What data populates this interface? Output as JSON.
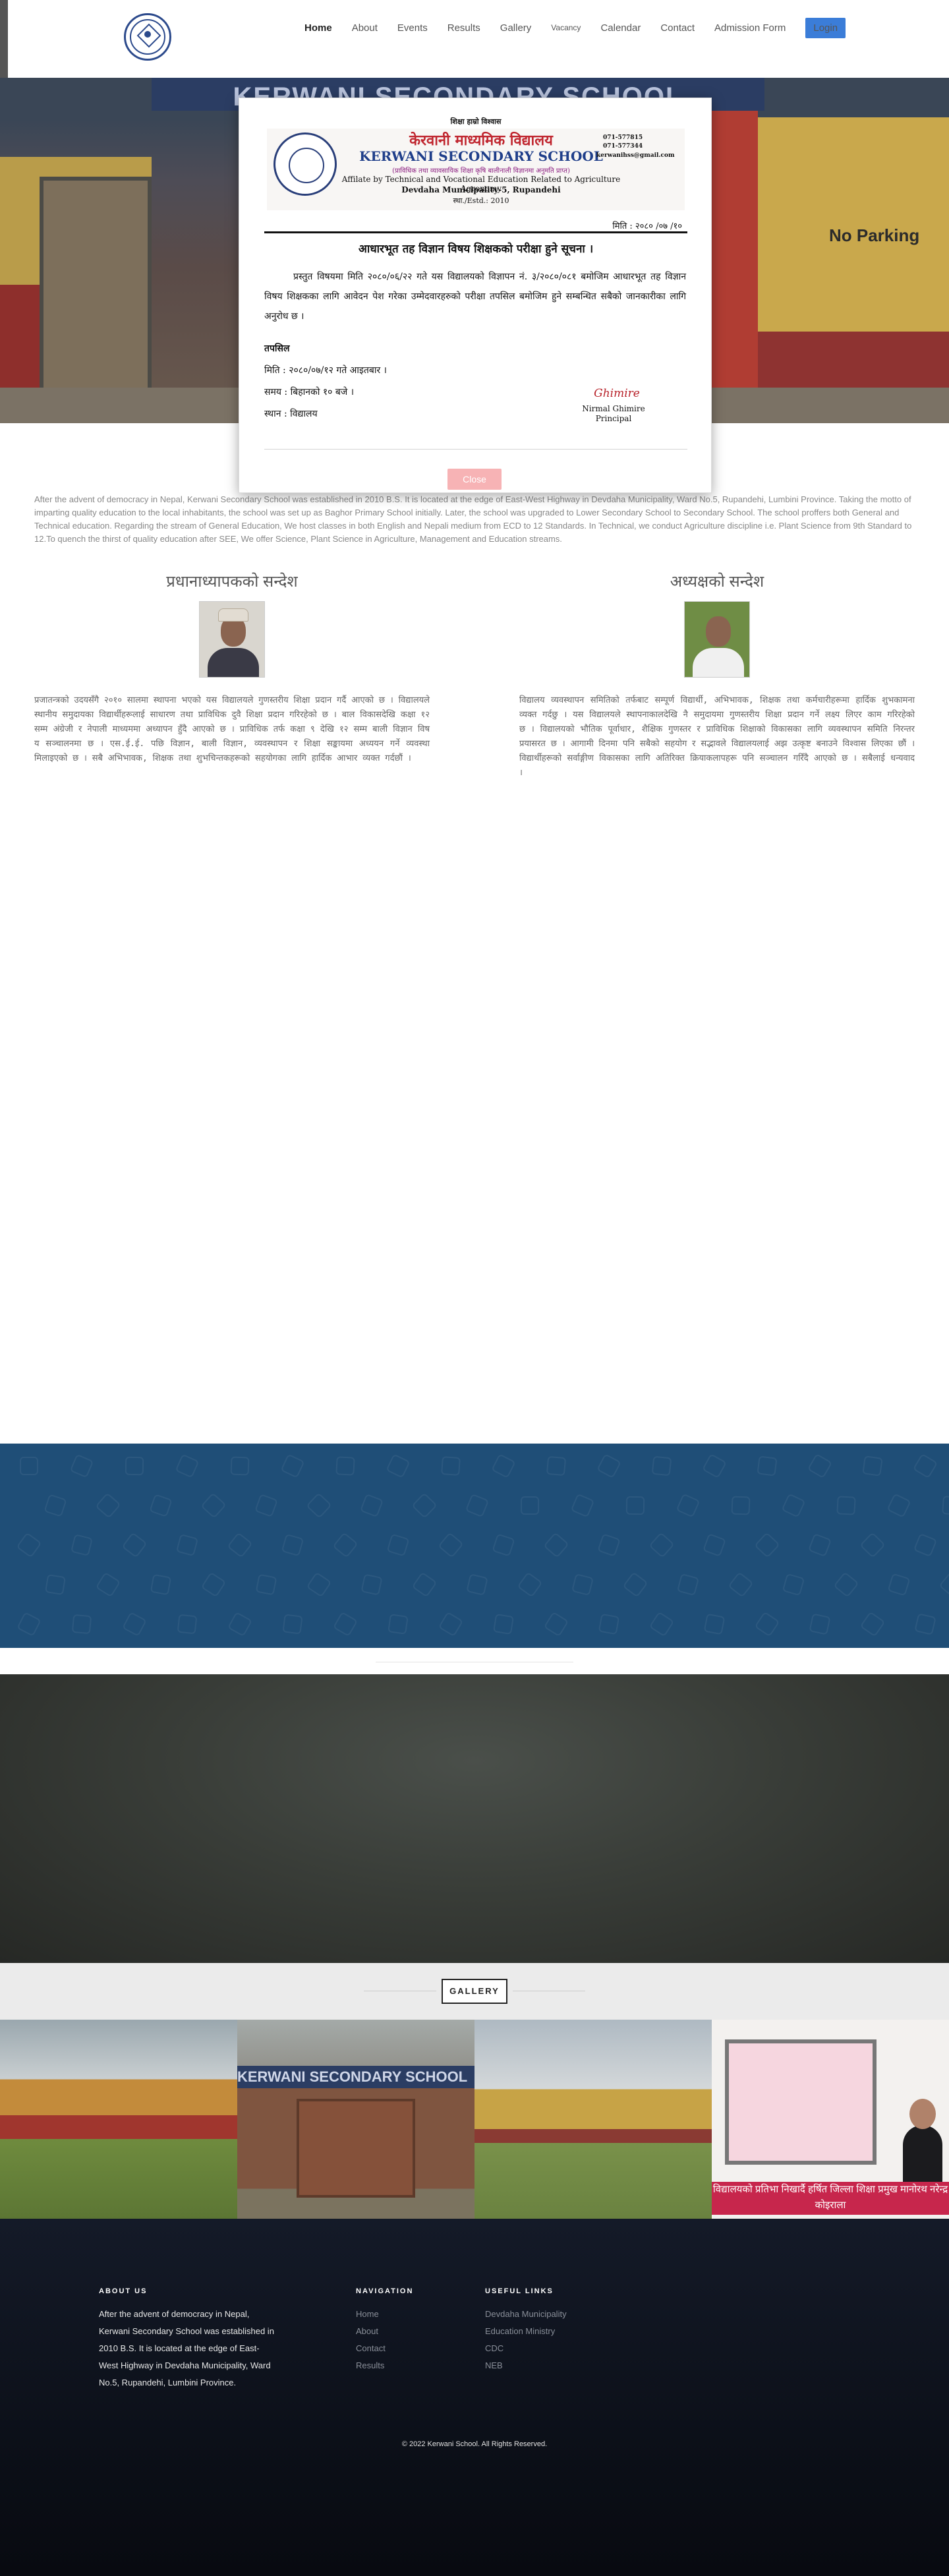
{
  "nav": {
    "items": [
      "Home",
      "About",
      "Events",
      "Results",
      "Gallery",
      "Vacancy",
      "Calendar",
      "Contact",
      "Admission Form"
    ],
    "login": "Login"
  },
  "hero": {
    "banner_text": "KERWANI SECONDARY SCHOOL",
    "sign_text": "No Parking"
  },
  "notice": {
    "top_line": "शिक्षा हाम्रो विश्वास",
    "school_np": "केरवानी माध्यमिक विद्यालय",
    "school_en": "KERWANI SECONDARY SCHOOL",
    "affiliation_np": "(प्राविधिक तथा व्यावसायिक शिक्षा कृषि बालीनाली विज्ञानमा अनुमति प्राप्त)",
    "affiliation_en": "Affilate by Technical and Vocational Education Related to Agriculture Agronomy",
    "address": "Devdaha Municipality-5, Rupandehi",
    "estd": "स्था./Estd.: 2010",
    "phone1": "071-577815",
    "phone2": "071-577344",
    "email": "kerwanihss@gmail.com",
    "date": "मिति : २०८० /०७ /१०",
    "title": "आधारभूत तह विज्ञान विषय शिक्षकको परीक्षा हुने सूचना ।",
    "body": "प्रस्तुत विषयमा मिति २०८०/०६/२२ गते यस विद्यालयको विज्ञापन नं. ३/२०८०/०८१ बमोजिम आधारभूत तह विज्ञान विषय शिक्षकका लागि आवेदन पेश गरेका उम्मेदवारहरुको परीक्षा तपसिल बमोजिम हुने सम्बन्धित सबैको जानकारीका लागि अनुरोध छ ।",
    "details_label": "तपसिल",
    "detail_date": "मिति : २०८०/०७/१२ गते आइतबार ।",
    "detail_time": "समय : बिहानको १० बजे ।",
    "detail_place": "स्थान : विद्यालय",
    "signature": "Ghimire",
    "signer_name": "Nirmal Ghimire",
    "signer_title": "Principal"
  },
  "modal": {
    "close_label": "Close"
  },
  "about": {
    "text": "After the advent of democracy in Nepal, Kerwani Secondary School was established in 2010 B.S. It is located at the edge of East-West Highway in Devdaha Municipality, Ward No.5, Rupandehi, Lumbini Province. Taking the motto of imparting quality education to the local inhabitants, the school was set up as Baghor Primary School initially. Later, the school was upgraded to Lower Secondary School to Secondary School. The school proffers both General and Technical education. Regarding the stream of General Education, We host classes in both English and Nepali medium from ECD to 12 Standards. In Technical, we conduct Agriculture discipline i.e. Plant Science from 9th Standard to 12.To quench the thirst of quality education after SEE, We offer Science, Plant Science in Agriculture, Management and Education streams."
  },
  "messages": {
    "left": {
      "heading": "प्रधानाध्यापकको सन्देश",
      "text": "प्रजातन्त्रको उदयसँगै २०१० सालमा स्थापना भएको यस विद्यालयले गुणस्तरीय शिक्षा प्रदान गर्दै आएको छ । विद्यालयले स्थानीय समुदायका विद्यार्थीहरूलाई साधारण तथा प्राविधिक दुवै शिक्षा प्रदान गरिरहेको छ । बाल विकासदेखि कक्षा १२ सम्म अंग्रेजी र नेपाली माध्यममा अध्यापन हुँदै आएको छ । प्राविधिक तर्फ कक्षा ९ देखि १२ सम्म बाली विज्ञान विषय सञ्चालनमा छ । एस.ई.ई. पछि विज्ञान, बाली विज्ञान, व्यवस्थापन र शिक्षा सङ्कायमा अध्ययन गर्ने व्यवस्था मिलाइएको छ । सबै अभिभावक, शिक्षक तथा शुभचिन्तकहरूको सहयोगका लागि हार्दिक आभार व्यक्त गर्दछौं ।"
    },
    "right": {
      "heading": "अध्यक्षको सन्देश",
      "text": "विद्यालय व्यवस्थापन समितिको तर्फबाट सम्पूर्ण विद्यार्थी, अभिभावक, शिक्षक तथा कर्मचारीहरूमा हार्दिक शुभकामना व्यक्त गर्दछु । यस विद्यालयले स्थापनाकालदेखि नै समुदायमा गुणस्तरीय शिक्षा प्रदान गर्ने लक्ष्य लिएर काम गरिरहेको छ । विद्यालयको भौतिक पूर्वाधार, शैक्षिक गुणस्तर र प्राविधिक शिक्षाको विकासका लागि व्यवस्थापन समिति निरन्तर प्रयासरत छ । आगामी दिनमा पनि सबैको सहयोग र सद्भावले विद्यालयलाई अझ उत्कृष्ट बनाउने विश्वास लिएका छौं । विद्यार्थीहरूको सर्वाङ्गीण विकासका लागि अतिरिक्त क्रियाकलापहरू पनि सञ्चालन गरिँदै आएको छ । सबैलाई धन्यवाद ।"
    }
  },
  "gallery": {
    "title": "GALLERY",
    "banner_text": "KERWANI SECONDARY SCHOOL",
    "caption": "विद्यालयको प्रतिभा निखार्दै हर्षित जिल्ला शिक्षा प्रमुख मानोरथ नरेन्द्र कोइराला"
  },
  "footer": {
    "about_heading": "ABOUT US",
    "about_text": "After the advent of democracy in Nepal, Kerwani Secondary School was established in 2010 B.S. It is located at the edge of East-West Highway in Devdaha Municipality, Ward No.5, Rupandehi, Lumbini Province.",
    "nav_heading": "NAVIGATION",
    "nav_links": [
      "Home",
      "About",
      "Contact",
      "Results"
    ],
    "useful_heading": "USEFUL LINKS",
    "useful_links": [
      "Devdaha Municipality",
      "Education Ministry",
      "CDC",
      "NEB"
    ],
    "copyright": "© 2022 Kerwani School. All Rights Reserved."
  }
}
